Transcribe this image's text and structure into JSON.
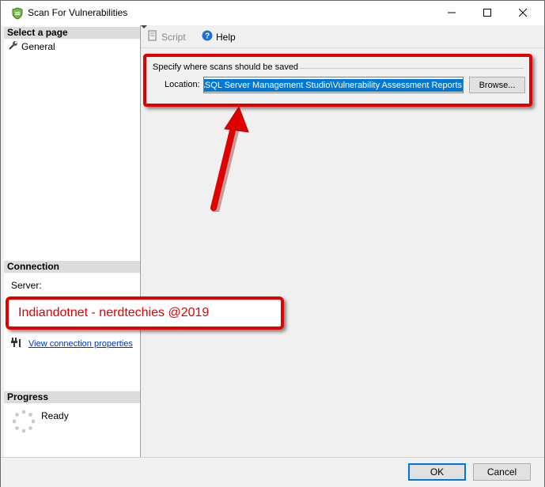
{
  "window": {
    "title": "Scan For Vulnerabilities"
  },
  "left_pane": {
    "select_page_header": "Select a page",
    "pages": [
      {
        "label": "General",
        "icon": "wrench-icon"
      }
    ],
    "connection_header": "Connection",
    "server_label": "Server:",
    "view_connection_link": "View connection properties",
    "progress_header": "Progress",
    "progress_status": "Ready"
  },
  "toolbar": {
    "script_label": "Script",
    "help_label": "Help"
  },
  "scan_location": {
    "group_title": "Specify where scans should be saved",
    "location_label": "Location:",
    "location_value": "nts\\SQL Server Management Studio\\Vulnerability Assessment Reports",
    "browse_label": "Browse..."
  },
  "watermark": {
    "text": "Indiandotnet - nerdtechies @2019"
  },
  "buttons": {
    "ok_label": "OK",
    "cancel_label": "Cancel"
  },
  "colors": {
    "accent": "#0078d7",
    "highlight": "#e00000",
    "header_bg": "#dcdcdc"
  }
}
